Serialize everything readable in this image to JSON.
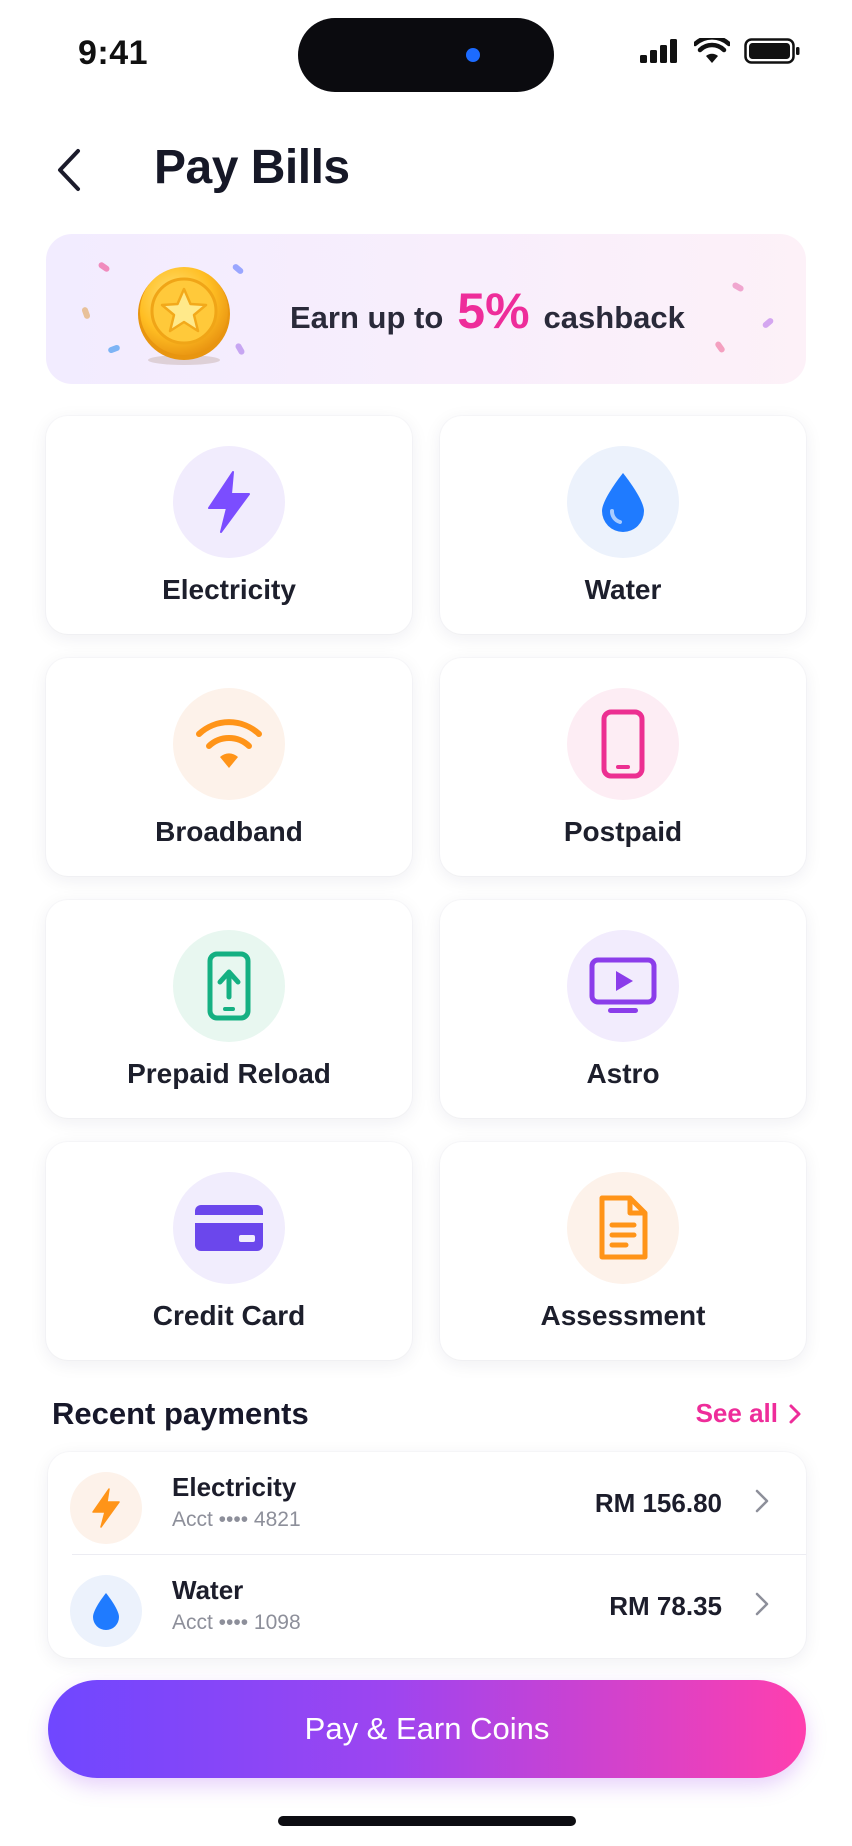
{
  "status_bar": {
    "time": "9:41"
  },
  "header": {
    "title": "Pay Bills",
    "back_icon": "chevron-left-icon"
  },
  "banner": {
    "prefix": "Earn up to",
    "percent": "5%",
    "suffix": "cashback",
    "icon": "star-coin-icon"
  },
  "categories": [
    {
      "label": "Electricity",
      "icon": "lightning-icon",
      "color": "#7b4dff",
      "bg": "#f1ecfd"
    },
    {
      "label": "Water",
      "icon": "water-drop-icon",
      "color": "#1f7bff",
      "bg": "#ecf2fc"
    },
    {
      "label": "Broadband",
      "icon": "wifi-icon",
      "color": "#ff9418",
      "bg": "#fdf2ea"
    },
    {
      "label": "Postpaid",
      "icon": "phone-icon",
      "color": "#ec2f91",
      "bg": "#fdedf4"
    },
    {
      "label": "Prepaid Reload",
      "icon": "phone-reload-icon",
      "color": "#15b082",
      "bg": "#e8f7f0"
    },
    {
      "label": "Astro",
      "icon": "tv-play-icon",
      "color": "#8b3dea",
      "bg": "#f2ecfd"
    },
    {
      "label": "Credit Card",
      "icon": "credit-card-icon",
      "color": "#6b47ec",
      "bg": "#f1edfd"
    },
    {
      "label": "Assessment",
      "icon": "document-icon",
      "color": "#ff9418",
      "bg": "#fdf2ea"
    }
  ],
  "recent": {
    "title": "Recent payments",
    "see_all": "See all",
    "items": [
      {
        "name": "Electricity",
        "account": "Acct •••• 4821",
        "amount": "RM 156.80",
        "icon": "lightning-icon"
      },
      {
        "name": "Water",
        "account": "Acct •••• 1098",
        "amount": "RM 78.35",
        "icon": "water-drop-icon"
      }
    ]
  },
  "cta": {
    "label": "Pay & Earn Coins"
  }
}
